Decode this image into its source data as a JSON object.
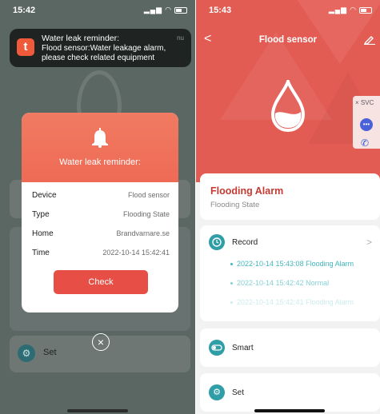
{
  "left_screen": {
    "status_time": "15:42",
    "notification": {
      "title": "Water leak reminder:",
      "body": "Flood sensor:Water leakage alarm, please check related equipment",
      "time": "nu",
      "app_icon_glyph": "t"
    },
    "modal": {
      "title": "Water leak reminder:",
      "rows": [
        {
          "label": "Device",
          "value": "Flood sensor"
        },
        {
          "label": "Type",
          "value": "Flooding State"
        },
        {
          "label": "Home",
          "value": "Brandvarnare.se"
        },
        {
          "label": "Time",
          "value": "2022-10-14 15:42:41"
        }
      ],
      "check_label": "Check",
      "close_glyph": "×"
    },
    "background": {
      "set_label": "Set"
    }
  },
  "right_screen": {
    "status_time": "15:43",
    "nav": {
      "back_glyph": "<",
      "title": "Flood sensor"
    },
    "svc": {
      "label": "× SVC"
    },
    "alarm_card": {
      "title": "Flooding Alarm",
      "subtitle": "Flooding State"
    },
    "record_card": {
      "label": "Record",
      "chevron": ">",
      "items": [
        "2022-10-14 15:43:08 Flooding Alarm",
        "2022-10-14 15:42:42 Normal",
        "2022-10-14 15:42:41 Flooding Alarm"
      ]
    },
    "smart_label": "Smart",
    "set_label": "Set"
  },
  "colors": {
    "accent_red": "#e35c54",
    "alarm_text": "#c63a33",
    "teal": "#2f9ea6",
    "record_text": "#3fb7bd",
    "check_button": "#e74f46"
  }
}
